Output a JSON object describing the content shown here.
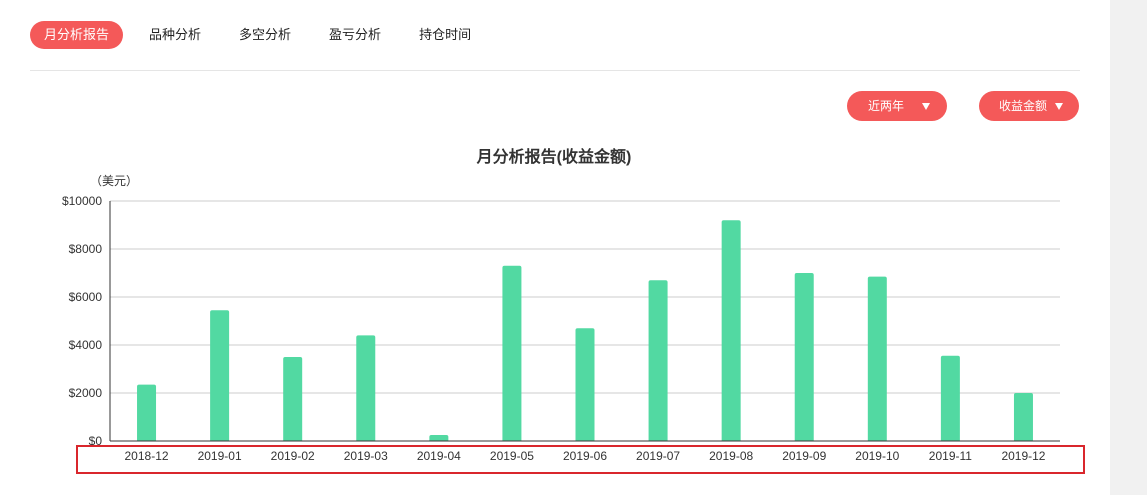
{
  "tabs": [
    {
      "label": "月分析报告",
      "active": true
    },
    {
      "label": "品种分析",
      "active": false
    },
    {
      "label": "多空分析",
      "active": false
    },
    {
      "label": "盈亏分析",
      "active": false
    },
    {
      "label": "持仓时间",
      "active": false
    }
  ],
  "filters": {
    "range_label": "近两年",
    "metric_label": "收益金额"
  },
  "colors": {
    "accent": "#f45959",
    "bar": "#52d9a2",
    "grid": "#cccccc",
    "highlight": "#d9262c"
  },
  "chart_data": {
    "type": "bar",
    "title": "月分析报告(收益金额)",
    "ylabel": "（美元）",
    "xlabel": "",
    "categories": [
      "2018-12",
      "2019-01",
      "2019-02",
      "2019-03",
      "2019-04",
      "2019-05",
      "2019-06",
      "2019-07",
      "2019-08",
      "2019-09",
      "2019-10",
      "2019-11",
      "2019-12"
    ],
    "values": [
      2350,
      5450,
      3500,
      4400,
      250,
      7300,
      4700,
      6700,
      9200,
      7000,
      6850,
      3550,
      2000
    ],
    "ylim": [
      0,
      10000
    ],
    "yticks": [
      0,
      2000,
      4000,
      6000,
      8000,
      10000
    ],
    "ytick_labels": [
      "$0",
      "$2000",
      "$4000",
      "$6000",
      "$8000",
      "$10000"
    ],
    "grid": true,
    "legend": false
  }
}
